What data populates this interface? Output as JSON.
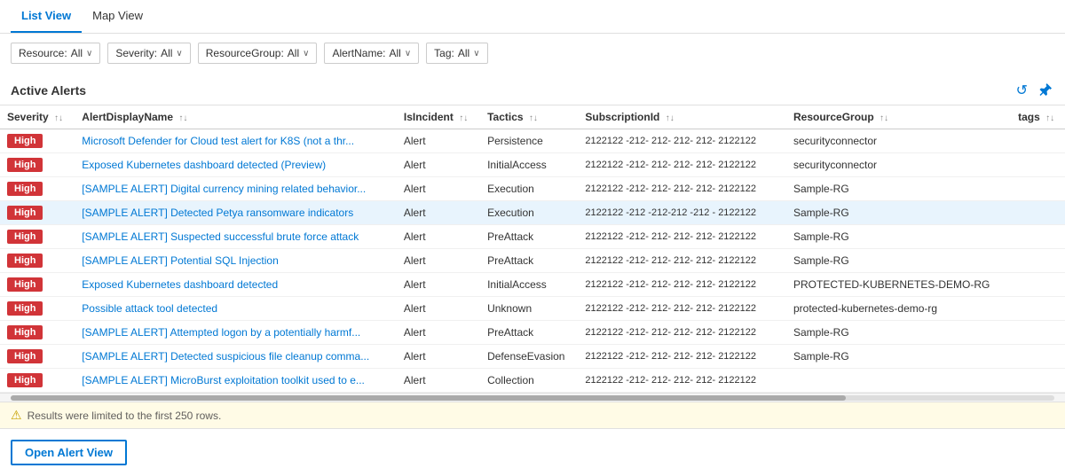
{
  "tabs": [
    {
      "id": "list-view",
      "label": "List View",
      "active": true
    },
    {
      "id": "map-view",
      "label": "Map View",
      "active": false
    }
  ],
  "filters": [
    {
      "id": "resource",
      "label": "Resource:",
      "value": "All"
    },
    {
      "id": "severity",
      "label": "Severity:",
      "value": "All"
    },
    {
      "id": "resourcegroup",
      "label": "ResourceGroup:",
      "value": "All"
    },
    {
      "id": "alertname",
      "label": "AlertName:",
      "value": "All"
    },
    {
      "id": "tag",
      "label": "Tag:",
      "value": "All"
    }
  ],
  "section_title": "Active Alerts",
  "columns": [
    {
      "id": "severity",
      "label": "Severity"
    },
    {
      "id": "alert-display-name",
      "label": "AlertDisplayName"
    },
    {
      "id": "is-incident",
      "label": "IsIncident"
    },
    {
      "id": "tactics",
      "label": "Tactics"
    },
    {
      "id": "subscription-id",
      "label": "SubscriptionId"
    },
    {
      "id": "resource-group",
      "label": "ResourceGroup"
    },
    {
      "id": "tags",
      "label": "tags"
    }
  ],
  "rows": [
    {
      "severity": "High",
      "alertName": "Microsoft Defender for Cloud test alert for K8S (not a thr...",
      "isIncident": "Alert",
      "tactics": "Persistence",
      "subscriptionId": "2122122 -212- 212- 212- 212- 2122122",
      "resourceGroup": "securityconnector",
      "tags": "",
      "selected": false
    },
    {
      "severity": "High",
      "alertName": "Exposed Kubernetes dashboard detected (Preview)",
      "isIncident": "Alert",
      "tactics": "InitialAccess",
      "subscriptionId": "2122122 -212- 212- 212- 212- 2122122",
      "resourceGroup": "securityconnector",
      "tags": "",
      "selected": false
    },
    {
      "severity": "High",
      "alertName": "[SAMPLE ALERT] Digital currency mining related behavior...",
      "isIncident": "Alert",
      "tactics": "Execution",
      "subscriptionId": "2122122 -212- 212- 212- 212- 2122122",
      "resourceGroup": "Sample-RG",
      "tags": "",
      "selected": false
    },
    {
      "severity": "High",
      "alertName": "[SAMPLE ALERT] Detected Petya ransomware indicators",
      "isIncident": "Alert",
      "tactics": "Execution",
      "subscriptionId": "2122122 -212 -212-212 -212 - 2122122",
      "resourceGroup": "Sample-RG",
      "tags": "",
      "selected": true
    },
    {
      "severity": "High",
      "alertName": "[SAMPLE ALERT] Suspected successful brute force attack",
      "isIncident": "Alert",
      "tactics": "PreAttack",
      "subscriptionId": "2122122 -212- 212- 212- 212- 2122122",
      "resourceGroup": "Sample-RG",
      "tags": "",
      "selected": false
    },
    {
      "severity": "High",
      "alertName": "[SAMPLE ALERT] Potential SQL Injection",
      "isIncident": "Alert",
      "tactics": "PreAttack",
      "subscriptionId": "2122122 -212- 212- 212- 212- 2122122",
      "resourceGroup": "Sample-RG",
      "tags": "",
      "selected": false
    },
    {
      "severity": "High",
      "alertName": "Exposed Kubernetes dashboard detected",
      "isIncident": "Alert",
      "tactics": "InitialAccess",
      "subscriptionId": "2122122 -212- 212- 212- 212- 2122122",
      "resourceGroup": "PROTECTED-KUBERNETES-DEMO-RG",
      "tags": "",
      "selected": false
    },
    {
      "severity": "High",
      "alertName": "Possible attack tool detected",
      "isIncident": "Alert",
      "tactics": "Unknown",
      "subscriptionId": "2122122 -212- 212- 212- 212- 2122122",
      "resourceGroup": "protected-kubernetes-demo-rg",
      "tags": "",
      "selected": false
    },
    {
      "severity": "High",
      "alertName": "[SAMPLE ALERT] Attempted logon by a potentially harmf...",
      "isIncident": "Alert",
      "tactics": "PreAttack",
      "subscriptionId": "2122122 -212- 212- 212- 212- 2122122",
      "resourceGroup": "Sample-RG",
      "tags": "",
      "selected": false
    },
    {
      "severity": "High",
      "alertName": "[SAMPLE ALERT] Detected suspicious file cleanup comma...",
      "isIncident": "Alert",
      "tactics": "DefenseEvasion",
      "subscriptionId": "2122122 -212- 212- 212- 212- 2122122",
      "resourceGroup": "Sample-RG",
      "tags": "",
      "selected": false
    },
    {
      "severity": "High",
      "alertName": "[SAMPLE ALERT] MicroBurst exploitation toolkit used to e...",
      "isIncident": "Alert",
      "tactics": "Collection",
      "subscriptionId": "2122122 -212- 212- 212- 212- 2122122",
      "resourceGroup": "",
      "tags": "",
      "selected": false
    }
  ],
  "footer": {
    "warning": "Results were limited to the first 250 rows.",
    "open_alert_btn": "Open Alert View"
  },
  "icons": {
    "refresh": "↺",
    "pin": "📌",
    "chevron_down": "⌄",
    "warning": "⚠"
  }
}
